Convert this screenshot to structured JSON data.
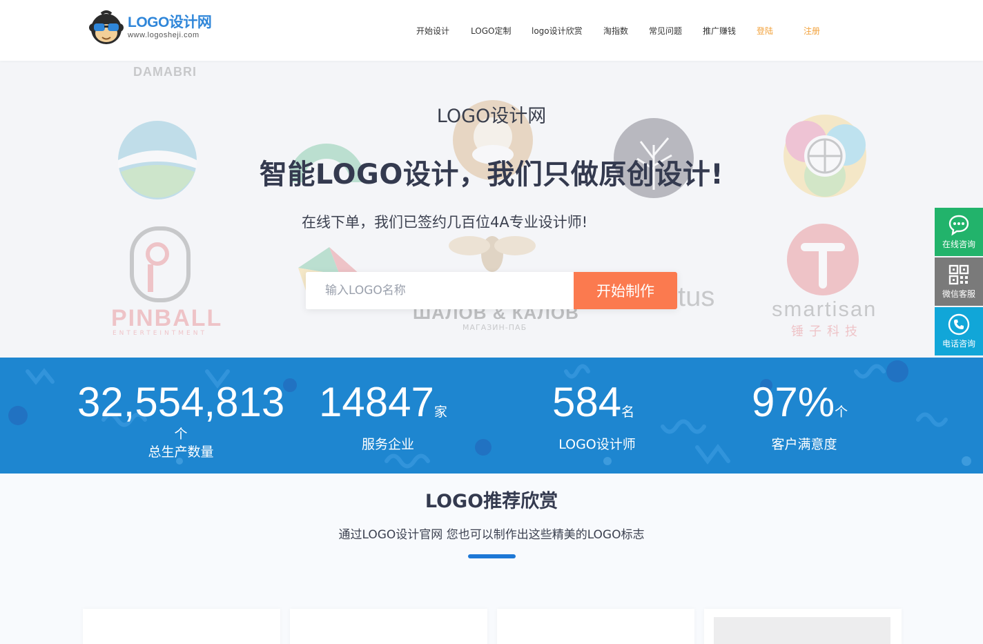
{
  "header": {
    "logo_title": "LOGO设计网",
    "logo_url": "www.logosheji.com",
    "nav": [
      {
        "label": "开始设计"
      },
      {
        "label": "LOGO定制"
      },
      {
        "label": "logo设计欣赏"
      },
      {
        "label": "淘指数"
      },
      {
        "label": "常见问题"
      },
      {
        "label": "推广赚钱"
      },
      {
        "label": "登陆"
      },
      {
        "label": "注册"
      }
    ]
  },
  "hero": {
    "site_name": "LOGO设计网",
    "title": "智能LOGO设计，我们只做原创设计!",
    "subtitle": "在线下单，我们已签约几百位4A专业设计师!",
    "search_placeholder": "输入LOGO名称",
    "search_button": "开始制作",
    "bg_logo_texts": {
      "damabri": "DAMABRI",
      "pinball": "PINBALL",
      "pinball_sub": "ENTERTEINTMENT",
      "smartisan": "smartisan",
      "smartisan_cn": "锤子科技",
      "tus": "tus",
      "magazin": "МАГАЗИН-ПАБ"
    }
  },
  "stats": [
    {
      "value": "32,554,813",
      "unit": "个",
      "label": "总生产数量"
    },
    {
      "value": "14847",
      "unit": "家",
      "label": "服务企业"
    },
    {
      "value": "584",
      "unit": "名",
      "label": "LOGO设计师"
    },
    {
      "value": "97%",
      "unit": "个",
      "label": "客户满意度"
    }
  ],
  "section": {
    "title": "LOGO推荐欣赏",
    "subtitle": "通过LOGO设计官网 您也可以制作出这些精美的LOGO标志"
  },
  "side": {
    "online": "在线咨询",
    "wechat": "微信客服",
    "phone": "电话咨询"
  },
  "colors": {
    "primary_blue": "#1e86d0",
    "accent_orange": "#fb7a4f",
    "nav_accent": "#f2a23c",
    "side_green": "#22b36b",
    "side_gray": "#7a7a7a",
    "side_cyan": "#11a6d8"
  }
}
